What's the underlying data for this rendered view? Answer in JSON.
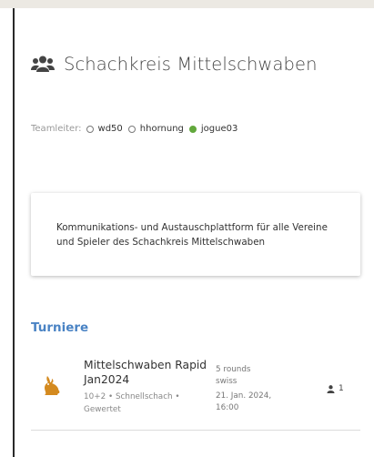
{
  "team": {
    "name": "Schachkreis Mittelschwaben",
    "leaders_label": "Teamleiter:",
    "leaders": [
      {
        "name": "wd50",
        "online": false
      },
      {
        "name": "hhornung",
        "online": false
      },
      {
        "name": "jogue03",
        "online": true
      }
    ],
    "description": "Kommunikations- und Austauschplattform für alle Vereine und Spieler des Schachkreis Mittelschwaben"
  },
  "tournaments": {
    "section_title": "Turniere",
    "items": [
      {
        "name": "Mittelschwaben Rapid Jan2024",
        "subtitle": "10+2 • Schnellschach • Gewertet",
        "rounds": "5 rounds",
        "system": "swiss",
        "date": "21. Jan. 2024, 16:00",
        "players": "1",
        "icon": "rabbit-icon"
      }
    ]
  },
  "colors": {
    "accent": "#4a83c4",
    "online": "#62a83c",
    "rabbit_icon": "#d48a1f"
  }
}
